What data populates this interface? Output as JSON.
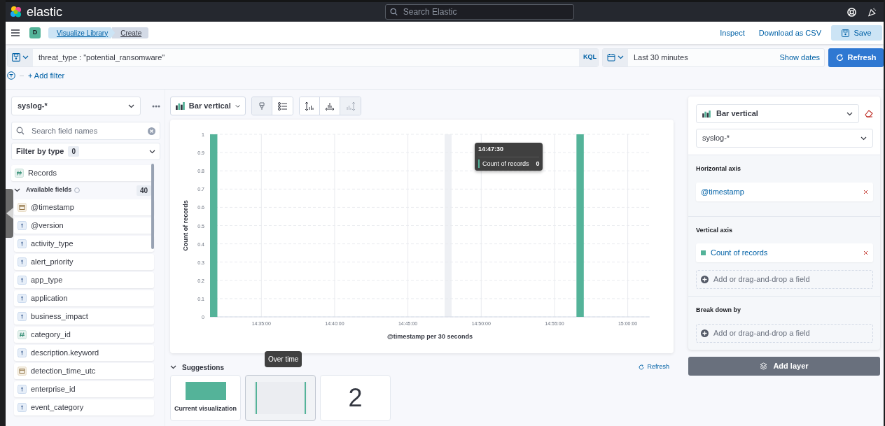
{
  "header": {
    "logo_text": "elastic",
    "search": {
      "placeholder": "Search Elastic"
    }
  },
  "app_bar": {
    "space_initial": "D",
    "breadcrumbs": [
      {
        "label": "Visualize Library",
        "selected": false
      },
      {
        "label": "Create",
        "selected": true
      }
    ],
    "actions": [
      "Inspect",
      "Download as CSV"
    ],
    "save_button": "Save"
  },
  "query_bar": {
    "query": "threat_type : \"potential_ransomware\"",
    "language": "KQL",
    "time_range": "Last 30 minutes",
    "show_dates": "Show dates",
    "refresh_button": "Refresh",
    "add_filter": "+ Add filter"
  },
  "sidebar": {
    "index_pattern": "syslog-*",
    "search": {
      "placeholder": "Search field names"
    },
    "filter_by_type": {
      "label": "Filter by type",
      "count": "0"
    },
    "records": {
      "label": "Records",
      "kind": "number"
    },
    "available_fields": {
      "label": "Available fields",
      "count": "40",
      "expanded": true,
      "fields": [
        {
          "label": "@timestamp",
          "kind": "date"
        },
        {
          "label": "@version",
          "kind": "string"
        },
        {
          "label": "activity_type",
          "kind": "string"
        },
        {
          "label": "alert_priority",
          "kind": "string"
        },
        {
          "label": "app_type",
          "kind": "string"
        },
        {
          "label": "application",
          "kind": "string"
        },
        {
          "label": "business_impact",
          "kind": "string"
        },
        {
          "label": "category_id",
          "kind": "number"
        },
        {
          "label": "description.keyword",
          "kind": "string"
        },
        {
          "label": "detection_time_utc",
          "kind": "date"
        },
        {
          "label": "enterprise_id",
          "kind": "string"
        },
        {
          "label": "event_category",
          "kind": "string"
        }
      ]
    }
  },
  "workspace": {
    "chart_type": "Bar vertical",
    "chart": {
      "chart_data": {
        "type": "bar",
        "xlabel": "@timestamp per 30 seconds",
        "ylabel": "Count of records",
        "categories": [
          null,
          null,
          null,
          null,
          null,
          null,
          null,
          "14:35:00",
          null,
          null,
          null,
          null,
          null,
          null,
          null,
          null,
          null,
          "14:40:00",
          null,
          null,
          null,
          null,
          null,
          null,
          null,
          null,
          null,
          "14:45:00",
          null,
          null,
          null,
          null,
          null,
          null,
          null,
          null,
          null,
          "14:50:00",
          null,
          null,
          null,
          null,
          null,
          null,
          null,
          null,
          null,
          "14:55:00",
          null,
          null,
          null,
          null,
          null,
          null,
          null,
          null,
          null,
          "15:00:00",
          null,
          null
        ],
        "series": [
          {
            "name": "Count of records",
            "color": "#54b399",
            "values": [
              1,
              0,
              0,
              0,
              0,
              0,
              0,
              0,
              0,
              0,
              0,
              0,
              0,
              0,
              0,
              0,
              0,
              0,
              0,
              0,
              0,
              0,
              0,
              0,
              0,
              0,
              0,
              0,
              0,
              0,
              0,
              0,
              0,
              0,
              0,
              0,
              0,
              0,
              0,
              0,
              0,
              0,
              0,
              0,
              0,
              0,
              0,
              0,
              0,
              0,
              1,
              0,
              0,
              0,
              0,
              0,
              0,
              0,
              0,
              0
            ]
          }
        ],
        "ylim": [
          0,
          1
        ],
        "yticks": [
          0,
          0.1,
          0.2,
          0.3,
          0.4,
          0.5,
          0.6,
          0.7,
          0.8,
          0.9,
          1
        ],
        "grid": true
      },
      "tooltip": {
        "title": "14:47:30",
        "value": "0"
      }
    },
    "suggestions": {
      "title": "Suggestions",
      "expanded": true,
      "refresh": "Refresh",
      "tooltip": "Over time",
      "items": [
        {
          "kind": "bar",
          "label": "Current visualization",
          "selected": false
        },
        {
          "kind": "line",
          "selected": true
        },
        {
          "kind": "metric",
          "value": "2",
          "selected": false
        }
      ]
    }
  },
  "config_panel": {
    "chart_type": "Bar vertical",
    "index_pattern": "syslog-*",
    "sections": [
      {
        "title": "Horizontal axis",
        "fields": [
          {
            "label": "@timestamp"
          }
        ]
      },
      {
        "title": "Vertical axis",
        "fields": [
          {
            "label": "Count of records",
            "color": "#54b399"
          }
        ],
        "add_placeholder": "Add or drag-and-drop a field"
      },
      {
        "title": "Break down by",
        "add_placeholder": "Add or drag-and-drop a field"
      }
    ]
  },
  "add_layer": "Add layer"
}
